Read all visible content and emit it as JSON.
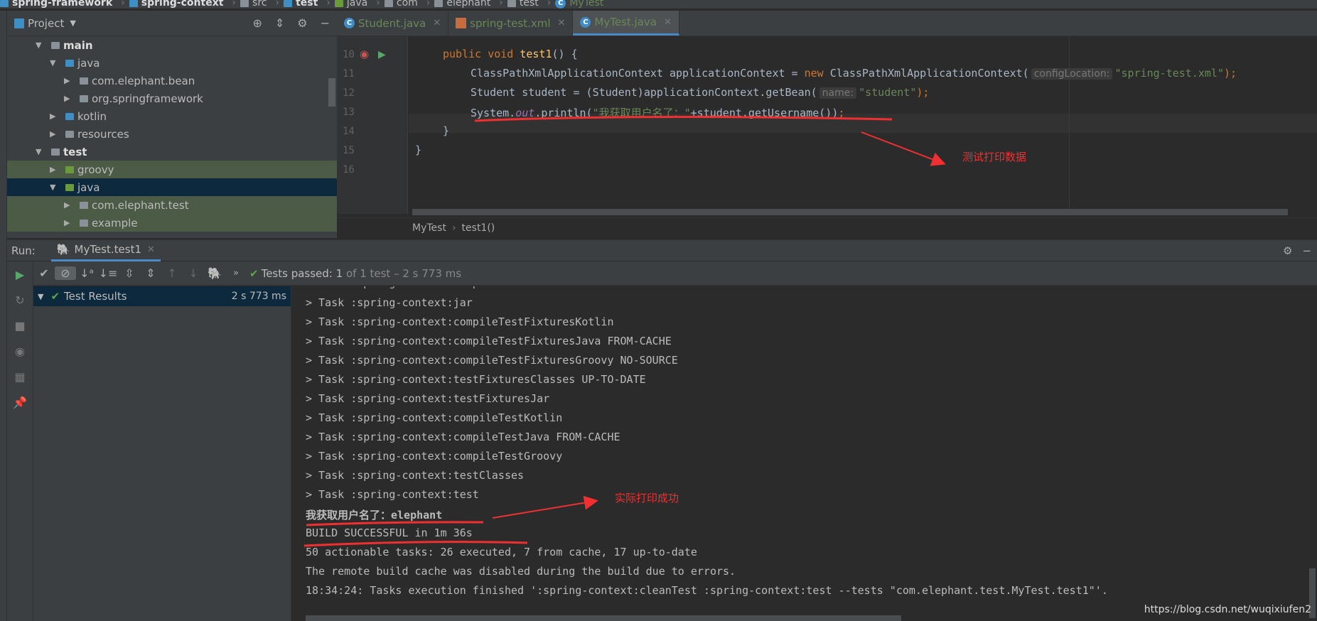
{
  "breadcrumb": [
    "spring-framework",
    "spring-context",
    "src",
    "test",
    "java",
    "com",
    "elephant",
    "test",
    "MyTest"
  ],
  "project": {
    "title": "Project",
    "tree": [
      {
        "label": "main",
        "level": 1,
        "open": true,
        "bold": true,
        "icon": "module-folder"
      },
      {
        "label": "java",
        "level": 2,
        "open": true,
        "icon": "source-folder"
      },
      {
        "label": "com.elephant.bean",
        "level": 3,
        "open": false,
        "icon": "package"
      },
      {
        "label": "org.springframework",
        "level": 3,
        "open": false,
        "icon": "package"
      },
      {
        "label": "kotlin",
        "level": 2,
        "open": false,
        "icon": "source-folder"
      },
      {
        "label": "resources",
        "level": 2,
        "open": false,
        "icon": "resource-folder"
      },
      {
        "label": "test",
        "level": 1,
        "open": true,
        "bold": true,
        "icon": "module-folder"
      },
      {
        "label": "groovy",
        "level": 2,
        "open": false,
        "icon": "test-folder",
        "state": "highlight"
      },
      {
        "label": "java",
        "level": 2,
        "open": true,
        "icon": "test-folder",
        "state": "selected"
      },
      {
        "label": "com.elephant.test",
        "level": 3,
        "open": false,
        "icon": "package",
        "state": "highlight"
      },
      {
        "label": "example",
        "level": 3,
        "open": false,
        "icon": "package",
        "state": "highlight"
      }
    ]
  },
  "tabs": [
    {
      "label": "Student.java",
      "icon": "class-icon"
    },
    {
      "label": "spring-test.xml",
      "icon": "xml-icon"
    },
    {
      "label": "MyTest.java",
      "icon": "class-icon",
      "active": true
    }
  ],
  "code": {
    "line_numbers": [
      "10",
      "11",
      "12",
      "13",
      "14",
      "15",
      "16"
    ],
    "l10": {
      "kw": "public void ",
      "fn": "test1",
      "rest": "() {"
    },
    "l11": {
      "a": "ClassPathXmlApplicationContext applicationContext = ",
      "kw": "new",
      "b": " ClassPathXmlApplicationContext(",
      "hint": "configLocation:",
      "str": "\"spring-test.xml\"",
      "end": ");"
    },
    "l12": {
      "a": "Student student = (Student)applicationContext.getBean(",
      "hint": "name:",
      "str": "\"student\"",
      "end": ");"
    },
    "l13": {
      "a": "System.",
      "it": "out",
      "b": ".println(",
      "str": "\"我获取用户名了：\"",
      "c": "+student.getUsername())",
      "end": ";"
    },
    "l14": "}",
    "l15": "}"
  },
  "editor_breadcrumb": [
    "MyTest",
    "test1()"
  ],
  "annotations": {
    "code": "测试打印数据",
    "console": "实际打印成功",
    "color": "#f03030"
  },
  "run": {
    "label": "Run:",
    "tab": "MyTest.test1",
    "status_prefix": "Tests passed:",
    "status_count": "1",
    "status_rest": "of 1 test – 2 s 773 ms",
    "result_label": "Test Results",
    "result_time": "2 s 773 ms"
  },
  "console": [
    "> Task :spring-context:jar",
    "> Task :spring-context:compileTestFixturesKotlin",
    "> Task :spring-context:compileTestFixturesJava FROM-CACHE",
    "> Task :spring-context:compileTestFixturesGroovy NO-SOURCE",
    "> Task :spring-context:testFixturesClasses UP-TO-DATE",
    "> Task :spring-context:testFixturesJar",
    "> Task :spring-context:compileTestKotlin",
    "> Task :spring-context:compileTestJava FROM-CACHE",
    "> Task :spring-context:compileTestGroovy",
    "> Task :spring-context:testClasses",
    "> Task :spring-context:test",
    "我获取用户名了：elephant",
    "BUILD SUCCESSFUL in 1m 36s",
    "50 actionable tasks: 26 executed, 7 from cache, 17 up-to-date",
    "The remote build cache was disabled during the build due to errors.",
    "18:34:24: Tasks execution finished ':spring-context:cleanTest :spring-context:test --tests \"com.elephant.test.MyTest.test1\"'."
  ],
  "console_partial_top": "> Task :spring-context:inspectClassesForKotlinIc",
  "watermark": "https://blog.csdn.net/wuqixiufen2"
}
